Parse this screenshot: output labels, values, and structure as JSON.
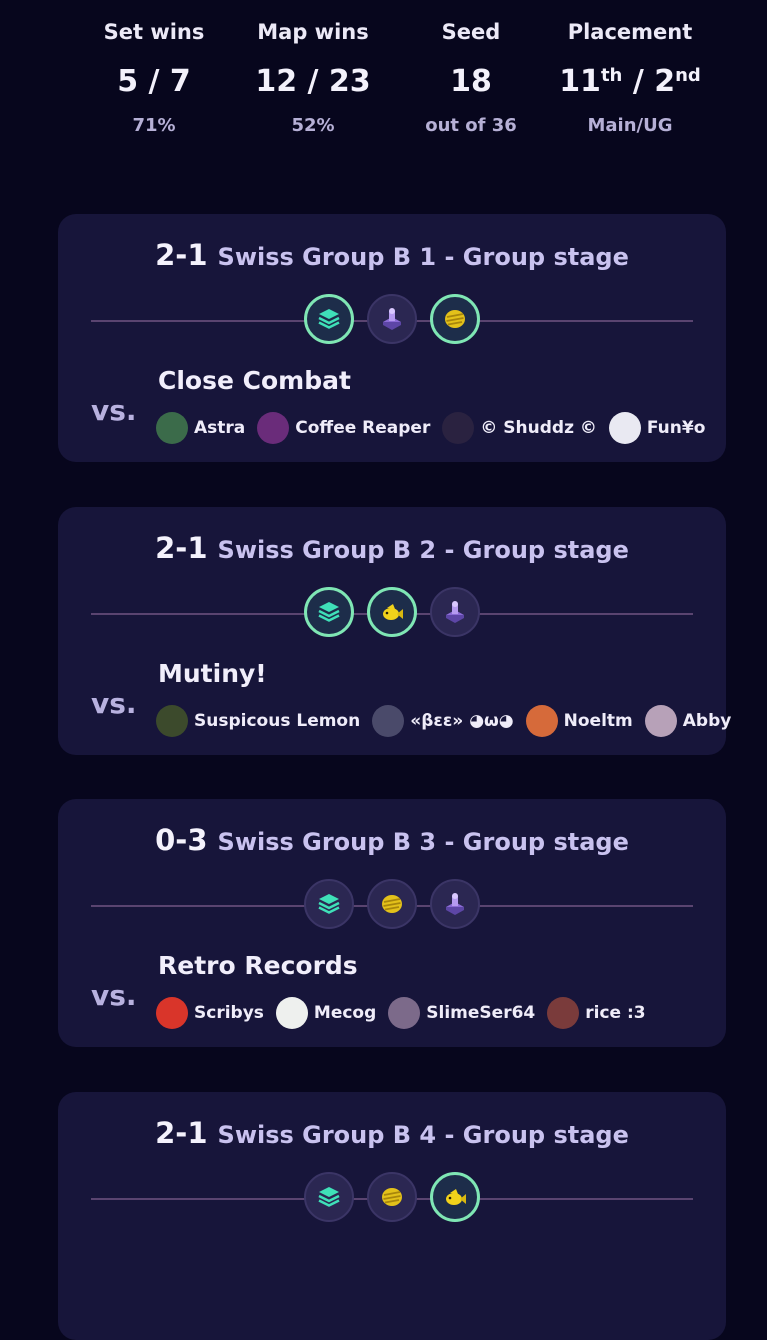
{
  "stats": [
    {
      "label": "Set wins",
      "value": "5 / 7",
      "sub": "71%"
    },
    {
      "label": "Map wins",
      "value": "12 / 23",
      "sub": "52%"
    },
    {
      "label": "Seed",
      "value": "18",
      "sub": "out of 36"
    },
    {
      "label": "Placement",
      "value_a": "11",
      "sup_a": "th",
      "sep": "/",
      "value_b": "2",
      "sup_b": "nd",
      "sub": "Main/UG"
    }
  ],
  "vs_label": "vs.",
  "matches": [
    {
      "score": "2-1",
      "stage": "Swiss Group B 1 - Group stage",
      "maps": [
        {
          "icon": "layers-icon",
          "won": true
        },
        {
          "icon": "tower-icon",
          "won": false
        },
        {
          "icon": "gold-coin-icon",
          "won": true
        }
      ],
      "team": "Close Combat",
      "players": [
        {
          "name": "Astra",
          "color": "#3b6b4a"
        },
        {
          "name": "Coffee Reaper",
          "color": "#6a2c7a"
        },
        {
          "name": "© Shuddz ©",
          "color": "#2a2240"
        },
        {
          "name": "Fun¥o",
          "color": "#e9e9f2"
        }
      ]
    },
    {
      "score": "2-1",
      "stage": "Swiss Group B 2 - Group stage",
      "maps": [
        {
          "icon": "layers-icon",
          "won": true
        },
        {
          "icon": "fish-icon",
          "won": true
        },
        {
          "icon": "tower-icon",
          "won": false
        }
      ],
      "team": "Mutiny!",
      "players": [
        {
          "name": "Suspicous Lemon",
          "color": "#3c4a2c"
        },
        {
          "name": "«βεε» ◕ω◕",
          "color": "#4a4a6a"
        },
        {
          "name": "Noeltm",
          "color": "#d66a3a"
        },
        {
          "name": "Abby",
          "color": "#b7a1b8"
        }
      ]
    },
    {
      "score": "0-3",
      "stage": "Swiss Group B 3 - Group stage",
      "maps": [
        {
          "icon": "layers-icon",
          "won": false
        },
        {
          "icon": "gold-coin-icon",
          "won": false
        },
        {
          "icon": "tower-icon",
          "won": false
        }
      ],
      "team": "Retro Records",
      "players": [
        {
          "name": "Scribys",
          "color": "#d9352a"
        },
        {
          "name": "Mecog",
          "color": "#eef0ee"
        },
        {
          "name": "SlimeSer64",
          "color": "#7c6a8a"
        },
        {
          "name": "rice :3",
          "color": "#7a3b3b"
        }
      ]
    },
    {
      "score": "2-1",
      "stage": "Swiss Group B 4 - Group stage",
      "maps": [
        {
          "icon": "layers-icon",
          "won": false
        },
        {
          "icon": "gold-coin-icon",
          "won": false
        },
        {
          "icon": "fish-icon",
          "won": true
        }
      ],
      "team": "",
      "players": []
    }
  ]
}
